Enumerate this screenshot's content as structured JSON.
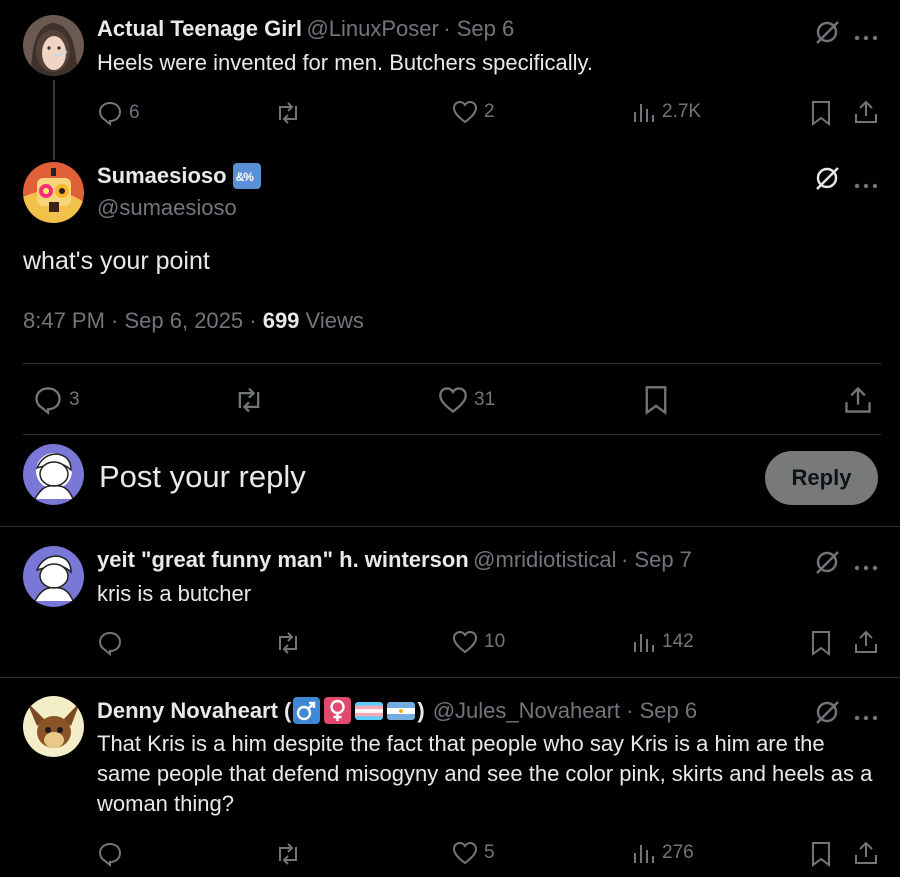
{
  "tweet1": {
    "name": "Actual Teenage Girl",
    "handle": "@LinuxPoser",
    "date": "· Sep 6",
    "text": "Heels were invented for men. Butchers specifically.",
    "replies": "6",
    "likes": "2",
    "views": "2.7K"
  },
  "main": {
    "name": "Sumaesioso",
    "badge_text": "&%",
    "handle": "@sumaesioso",
    "text": "what's your point",
    "time": "8:47 PM · Sep 6, 2025 ·",
    "views_count": "699",
    "views_label": "Views",
    "replies": "3",
    "likes": "31"
  },
  "composer": {
    "placeholder": "Post your reply",
    "button": "Reply"
  },
  "tweet2": {
    "name": "yeit \"great funny man\" h. winterson",
    "handle": "@mridiotistical",
    "date": "· Sep 7",
    "text": "kris is a butcher",
    "likes": "10",
    "views": "142"
  },
  "tweet3": {
    "name_prefix": "Denny Novaheart (",
    "name_suffix": ")",
    "handle": "@Jules_Novaheart",
    "date": "· Sep 6",
    "text": "That Kris is a him despite the fact that people who say Kris is a him are the same people that defend misogyny and see the color pink, skirts and heels as a woman thing?",
    "likes": "5",
    "views": "276"
  },
  "colors": {
    "background": "#000000",
    "text": "#e7e9ea",
    "muted": "#71767b",
    "divider": "#2f3336",
    "reply_button": "#787a7a"
  }
}
